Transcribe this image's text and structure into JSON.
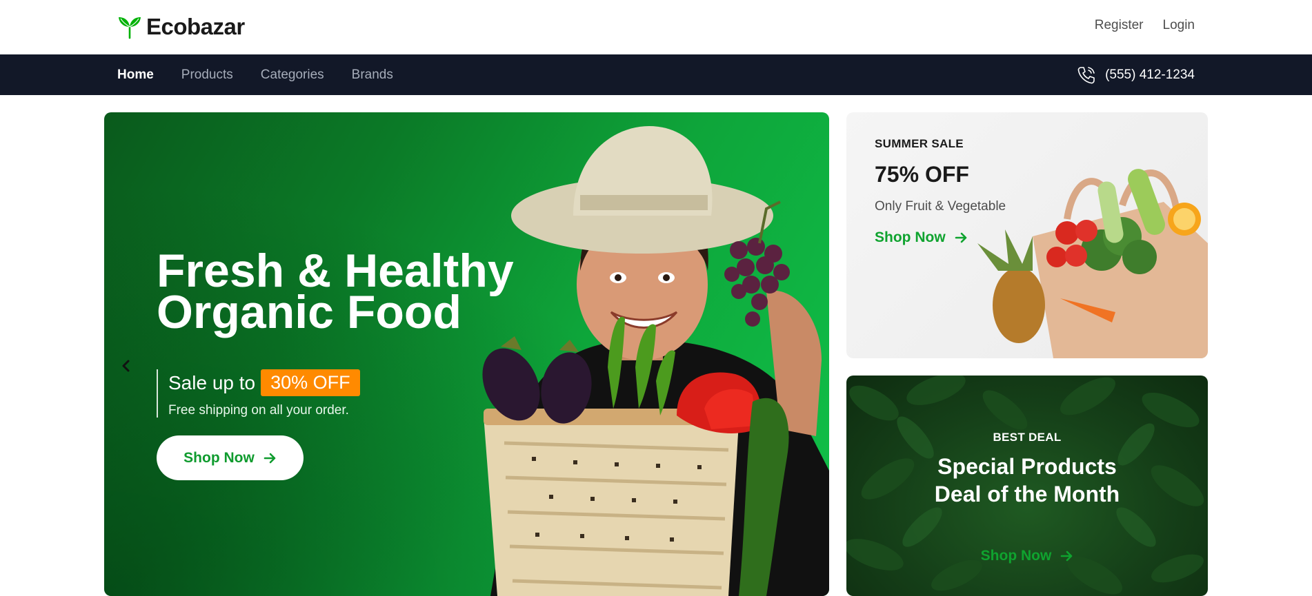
{
  "brand": {
    "name": "Ecobazar",
    "icon": "leaf-sprout-icon",
    "color": "#00b207"
  },
  "auth": {
    "register": "Register",
    "login": "Login"
  },
  "nav": {
    "items": [
      {
        "label": "Home",
        "active": true
      },
      {
        "label": "Products",
        "active": false
      },
      {
        "label": "Categories",
        "active": false
      },
      {
        "label": "Brands",
        "active": false
      }
    ],
    "phone": "(555) 412-1234",
    "phone_icon": "phone-call-icon"
  },
  "hero": {
    "title_line1": "Fresh & Healthy",
    "title_line2": "Organic Food",
    "sale_prefix": "Sale up to",
    "sale_badge": "30% OFF",
    "sale_sub": "Free shipping on all your order.",
    "button": "Shop Now",
    "prev_icon": "chevron-left-icon",
    "badge_color": "#ff8a00"
  },
  "summer": {
    "label": "SUMMER SALE",
    "discount": "75% OFF",
    "subtitle": "Only Fruit & Vegetable",
    "link": "Shop Now"
  },
  "deal": {
    "label": "BEST DEAL",
    "title": "Special Products Deal of the Month",
    "link": "Shop Now"
  },
  "colors": {
    "accent": "#00b207",
    "navbar": "#121828"
  }
}
